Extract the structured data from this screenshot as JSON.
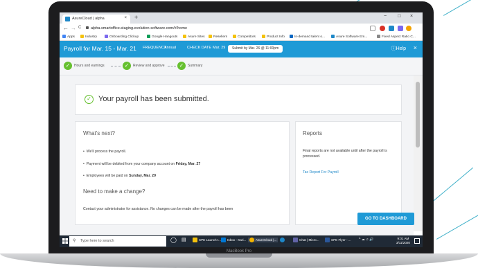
{
  "device": {
    "label": "MacBook Pro"
  },
  "browser": {
    "tab_title": "AsureCloud | alpha",
    "tab_close": "×",
    "new_tab": "+",
    "url": "alpha.smartoffice.staging.evolution-software.com/#/home",
    "window": {
      "minimize": "−",
      "maximize": "□",
      "close": "×"
    },
    "nav": {
      "back": "←",
      "forward": "→",
      "reload": "C"
    },
    "bookmarks": [
      {
        "label": "Apps",
        "color": "#4285f4"
      },
      {
        "label": "Industry",
        "color": "#f4c20d"
      },
      {
        "label": "Onboarding Clickup",
        "color": "#7b68ee"
      },
      {
        "label": "Google Hangouts",
        "color": "#0f9d58"
      },
      {
        "label": "Asure Sites",
        "color": "#f4c20d"
      },
      {
        "label": "Resellers",
        "color": "#f4c20d"
      },
      {
        "label": "Competitors",
        "color": "#f4c20d"
      },
      {
        "label": "Product Info",
        "color": "#f4c20d"
      },
      {
        "label": "In-demand talent o...",
        "color": "#0a66c2"
      },
      {
        "label": "Asure Software Em...",
        "color": "#1e88c8"
      },
      {
        "label": "Fixed Aspect Ratio C...",
        "color": "#888888"
      }
    ]
  },
  "header": {
    "payroll_period": "Payroll for Mar. 15 - Mar. 21",
    "frequency_label": "FREQUENCY",
    "frequency_value": "Annual",
    "check_date_label": "CHECK DATE",
    "check_date_value": "Mar. 29",
    "submit_by": "Submit by Mar. 26 @ 11:00pm",
    "help": "Help",
    "close": "×",
    "accent": "#1f9ad6"
  },
  "steps": [
    {
      "label": "Hours and earnings"
    },
    {
      "label": "Review and approve"
    },
    {
      "label": "Summary"
    }
  ],
  "confirmation": {
    "icon": "check-circle-icon",
    "text": "Your payroll has been submitted."
  },
  "whats_next": {
    "title": "What's next?",
    "items": [
      {
        "text": "We'll process the payroll.",
        "bold": ""
      },
      {
        "text": "Payment will be debited from your company account on ",
        "bold": "Friday, Mar. 27"
      },
      {
        "text": "Employees will be paid on ",
        "bold": "Sunday, Mar. 29"
      }
    ],
    "change_title": "Need to make a change?",
    "change_text": "Contact your administrator for assistance. No changes can be made after the payroll has been"
  },
  "reports": {
    "title": "Reports",
    "text": "Final reports are not available until after the payroll is processed.",
    "link": "Tax Report For Payroll"
  },
  "dashboard_button": "GO TO DASHBOARD",
  "taskbar": {
    "search_placeholder": "Type here to search",
    "items": [
      {
        "label": "SPE Launch t...",
        "color": "#f4c20d"
      },
      {
        "label": "Inbox - Kari...",
        "color": "#0078d4"
      },
      {
        "label": "AsureCloud |...",
        "color": "#f4b400"
      },
      {
        "label": "",
        "color": "#1e88c8"
      },
      {
        "label": "Chat | Micro...",
        "color": "#6264a7"
      },
      {
        "label": "SPE Flyer - ...",
        "color": "#2b579a"
      }
    ],
    "time": "9:01 AM",
    "date": "3/11/2020"
  }
}
